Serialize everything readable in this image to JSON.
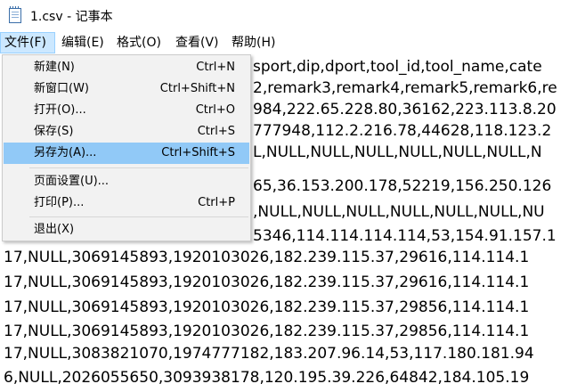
{
  "window": {
    "title": "1.csv - 记事本",
    "app_icon": "notepad-icon"
  },
  "menubar": {
    "items": [
      {
        "label": "文件(F)"
      },
      {
        "label": "编辑(E)"
      },
      {
        "label": "格式(O)"
      },
      {
        "label": "查看(V)"
      },
      {
        "label": "帮助(H)"
      }
    ],
    "active": "文件(F)"
  },
  "file_menu": {
    "items": [
      {
        "label": "新建(N)",
        "shortcut": "Ctrl+N"
      },
      {
        "label": "新窗口(W)",
        "shortcut": "Ctrl+Shift+N"
      },
      {
        "label": "打开(O)...",
        "shortcut": "Ctrl+O"
      },
      {
        "label": "保存(S)",
        "shortcut": "Ctrl+S"
      },
      {
        "label": "另存为(A)...",
        "shortcut": "Ctrl+Shift+S"
      },
      {
        "label": "页面设置(U)...",
        "shortcut": ""
      },
      {
        "label": "打印(P)...",
        "shortcut": "Ctrl+P"
      },
      {
        "label": "退出(X)",
        "shortcut": ""
      }
    ],
    "highlighted": "另存为(A)..."
  },
  "editor": {
    "lines": [
      "sport,dip,dport,tool_id,tool_name,cate",
      "2,remark3,remark4,remark5,remark6,re",
      "984,222.65.228.80,36162,223.113.8.20",
      "777948,112.2.216.78,44628,118.123.2",
      "L,NULL,NULL,NULL,NULL,NULL,NULL,N",
      "65,36.153.200.178,52219,156.250.126",
      ",NULL,NULL,NULL,NULL,NULL,NULL,NU",
      "5346,114.114.114.114,53,154.91.157.1",
      "17,NULL,3069145893,1920103026,182.239.115.37,29616,114.114.1",
      "17,NULL,3069145893,1920103026,182.239.115.37,29616,114.114.1",
      "17,NULL,3069145893,1920103026,182.239.115.37,29856,114.114.1",
      "17,NULL,3069145893,1920103026,182.239.115.37,29856,114.114.1",
      "17,NULL,3083821070,1974777182,183.207.96.14,53,117.180.181.94",
      "6,NULL,2026055650,3093938178,120.195.39.226,64842,184.105.19"
    ]
  }
}
